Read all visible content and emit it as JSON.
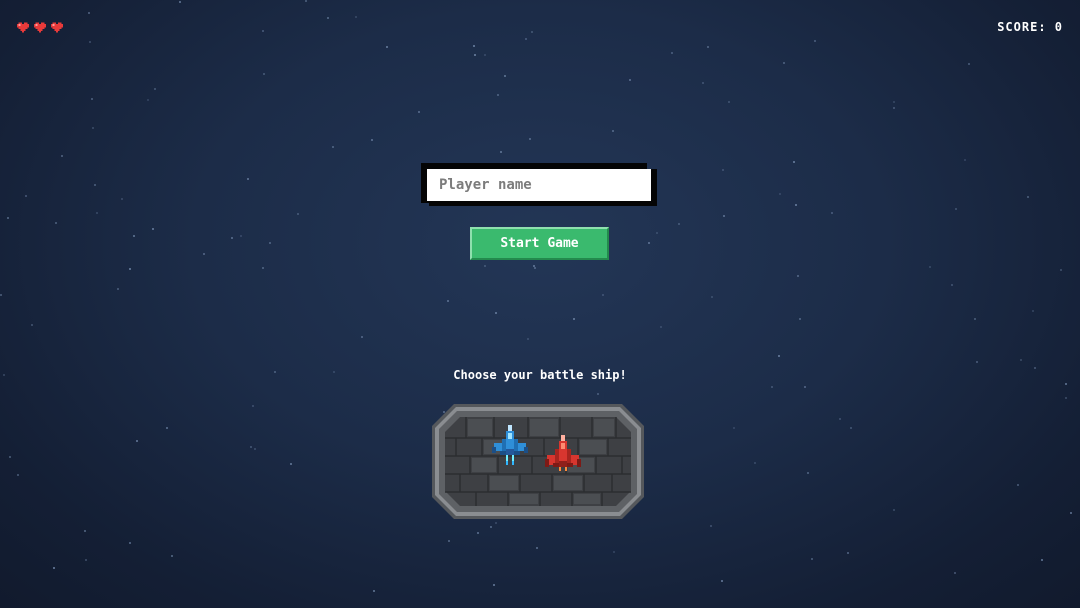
{
  "hud": {
    "lives": 3,
    "heart_color": "#e83a3a",
    "score_text": "SCORE: 0"
  },
  "menu": {
    "name_placeholder": "Player name",
    "name_value": "",
    "start_label": "Start Game",
    "choose_label": "Choose your battle ship!"
  },
  "ships": [
    {
      "name": "blue-ship",
      "color": "#2f8fd8"
    },
    {
      "name": "red-ship",
      "color": "#d8362f"
    }
  ],
  "colors": {
    "background": "#1c2c48",
    "start_button": "#3aba6e",
    "hangar_frame": "#7f8286",
    "hangar_floor": "#47494d"
  }
}
